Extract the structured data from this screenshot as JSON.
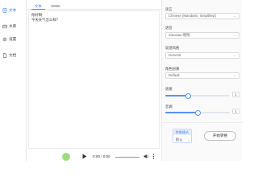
{
  "sidebar": {
    "items": [
      {
        "label": "文本",
        "icon": "text-icon",
        "active": true
      },
      {
        "label": "水库",
        "icon": "library-icon",
        "active": false
      },
      {
        "label": "设置",
        "icon": "gear-icon",
        "active": false
      },
      {
        "label": "文档",
        "icon": "document-icon",
        "active": false
      }
    ]
  },
  "tabs": [
    {
      "label": "文本",
      "active": true
    },
    {
      "label": "SSML",
      "active": false
    }
  ],
  "editor": {
    "lines": [
      "你好啊",
      "今天天气怎么样？"
    ]
  },
  "settings": {
    "language_label": "语言",
    "language_value": "Chinese (Mandarin, Simplified)",
    "voice_label": "语音",
    "voice_value": "Xiaoxiao-晓晓",
    "style_label": "说话风格",
    "style_value": "General",
    "role_label": "角色扮演",
    "role_value": "Default",
    "rate_label": "语速",
    "rate_value": "1",
    "rate_level": 0.35,
    "pitch_label": "音调",
    "pitch_value": "1",
    "pitch_level": 0.5
  },
  "footer": {
    "mode_title": "转换模式",
    "mode_value": "默认",
    "start_button": "开始转换"
  },
  "player": {
    "time": "0:00 / 0:00"
  },
  "colors": {
    "accent": "#3a7cf0",
    "slider": "#5b8ff7"
  }
}
